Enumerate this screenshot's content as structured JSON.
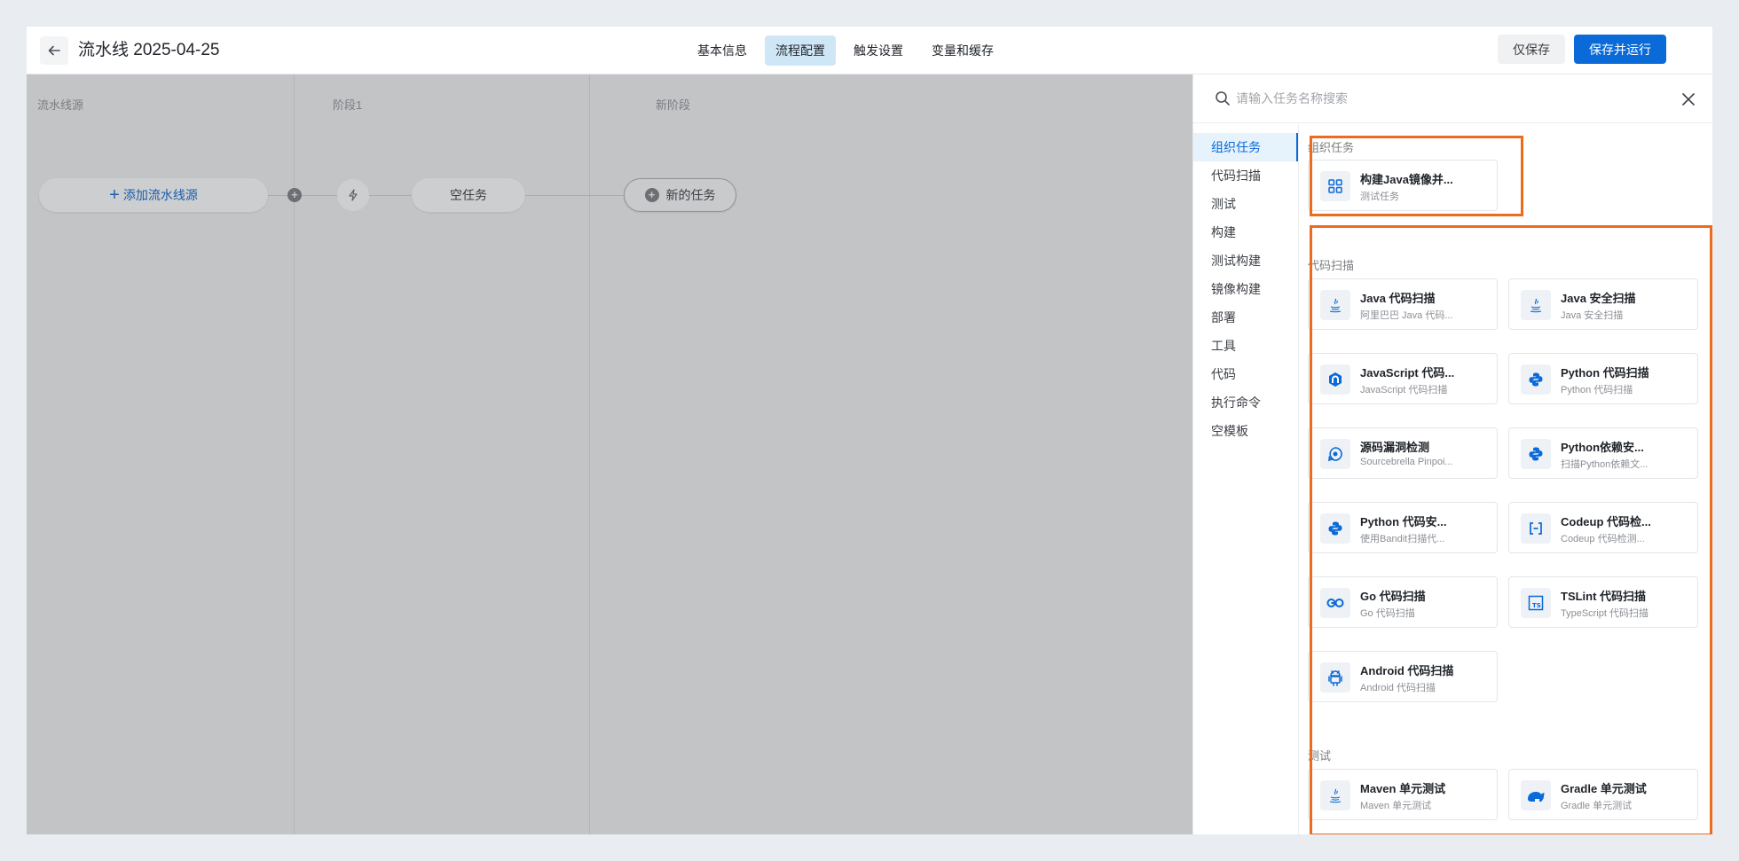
{
  "header": {
    "back_icon": "arrow-left-icon",
    "title": "流水线 2025-04-25",
    "tabs": [
      {
        "label": "基本信息",
        "active": false
      },
      {
        "label": "流程配置",
        "active": true
      },
      {
        "label": "触发设置",
        "active": false
      },
      {
        "label": "变量和缓存",
        "active": false
      }
    ],
    "save_label": "仅保存",
    "save_run_label": "保存并运行",
    "accent": "#0a6ad8"
  },
  "canvas": {
    "stages": [
      {
        "title": "流水线源"
      },
      {
        "title": "阶段1"
      },
      {
        "title": "新阶段"
      }
    ],
    "add_source_label": "添加流水线源",
    "empty_task_label": "空任务",
    "new_task_label": "新的任务"
  },
  "panel": {
    "search_placeholder": "请输入任务名称搜索",
    "categories": [
      {
        "label": "组织任务",
        "active": true
      },
      {
        "label": "代码扫描",
        "active": false
      },
      {
        "label": "测试",
        "active": false
      },
      {
        "label": "构建",
        "active": false
      },
      {
        "label": "测试构建",
        "active": false
      },
      {
        "label": "镜像构建",
        "active": false
      },
      {
        "label": "部署",
        "active": false
      },
      {
        "label": "工具",
        "active": false
      },
      {
        "label": "代码",
        "active": false
      },
      {
        "label": "执行命令",
        "active": false
      },
      {
        "label": "空模板",
        "active": false
      }
    ],
    "sections": {
      "org": {
        "title": "组织任务",
        "tasks": [
          {
            "name": "构建Java镜像并...",
            "desc": "测试任务",
            "icon": "grid-icon"
          }
        ]
      },
      "scan": {
        "title": "代码扫描",
        "tasks": [
          {
            "name": "Java 代码扫描",
            "desc": "阿里巴巴 Java 代码...",
            "icon": "java-icon"
          },
          {
            "name": "Java 安全扫描",
            "desc": "Java 安全扫描",
            "icon": "java-icon"
          },
          {
            "name": "JavaScript 代码...",
            "desc": "JavaScript 代码扫描",
            "icon": "javascript-icon"
          },
          {
            "name": "Python 代码扫描",
            "desc": "Python 代码扫描",
            "icon": "python-icon"
          },
          {
            "name": "源码漏洞检测",
            "desc": "Sourcebrella Pinpoi...",
            "icon": "sourcebrella-icon"
          },
          {
            "name": "Python依赖安...",
            "desc": "扫描Python依赖文...",
            "icon": "python-icon"
          },
          {
            "name": "Python 代码安...",
            "desc": "使用Bandit扫描代...",
            "icon": "python-icon"
          },
          {
            "name": "Codeup 代码检...",
            "desc": "Codeup 代码检测...",
            "icon": "codeup-icon"
          },
          {
            "name": "Go 代码扫描",
            "desc": "Go 代码扫描",
            "icon": "go-icon"
          },
          {
            "name": "TSLint 代码扫描",
            "desc": "TypeScript 代码扫描",
            "icon": "typescript-icon"
          },
          {
            "name": "Android 代码扫描",
            "desc": "Android 代码扫描",
            "icon": "android-icon"
          }
        ]
      },
      "test": {
        "title": "测试",
        "tasks": [
          {
            "name": "Maven 单元测试",
            "desc": "Maven 单元测试",
            "icon": "java-icon"
          },
          {
            "name": "Gradle 单元测试",
            "desc": "Gradle 单元测试",
            "icon": "gradle-icon"
          }
        ]
      }
    },
    "highlight_color": "#ec6b1c"
  }
}
